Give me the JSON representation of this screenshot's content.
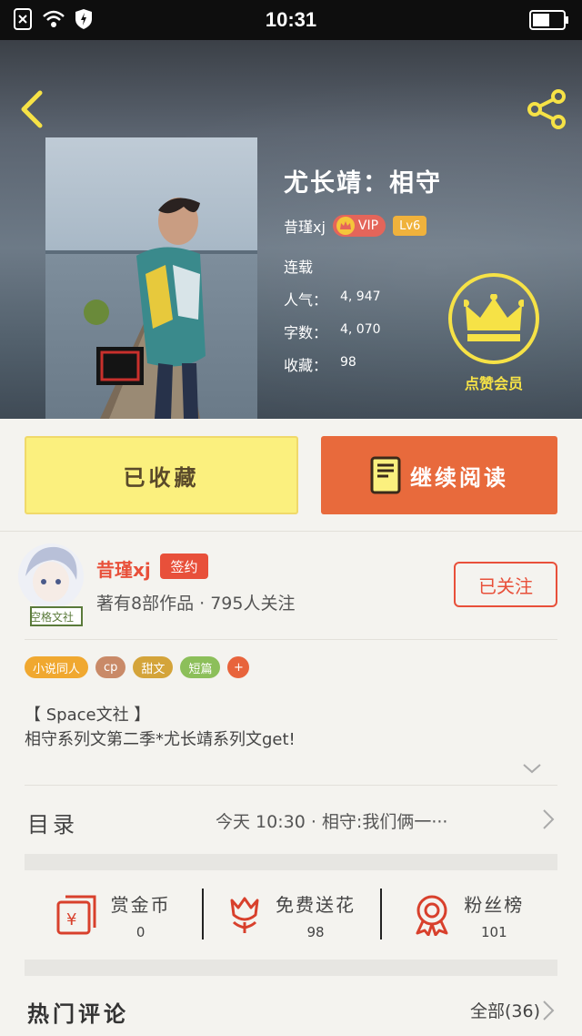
{
  "status_bar": {
    "time": "10:31"
  },
  "header": {
    "back_icon": "chevron-left-icon",
    "share_icon": "share-icon",
    "accent": "#f6e246"
  },
  "book": {
    "title": "尤长靖：相守",
    "author": "昔瑾xj",
    "vip_label": "VIP",
    "level": "Lv6",
    "status": "连载",
    "popularity_label": "人气：",
    "popularity": "4, 947",
    "words_label": "字数：",
    "words": "4, 070",
    "favorites_label": "收藏：",
    "favorites": "98"
  },
  "member": {
    "label": "点赞会员"
  },
  "actions": {
    "collected_label": "已收藏",
    "read_label": "继续阅读",
    "collected_color": "#fbf07e",
    "read_color": "#e86a3c"
  },
  "author_section": {
    "name": "昔瑾xj",
    "sign_badge": "签约",
    "meta": "著有8部作品 · 795人关注",
    "follow_label": "已关注",
    "avatar_caption": "空格文社"
  },
  "tags": [
    {
      "label": "小说同人",
      "color": "#f0a830"
    },
    {
      "label": "cp",
      "color": "#c98a68"
    },
    {
      "label": "甜文",
      "color": "#d4a43a"
    },
    {
      "label": "短篇",
      "color": "#8cbf5a"
    },
    {
      "label": "+",
      "color": "#e8643c"
    }
  ],
  "description": {
    "line1": "【 Space文社 】",
    "line2": "相守系列文第二季*尤长靖系列文get!"
  },
  "catalog": {
    "title": "目录",
    "latest": "今天 10:30 · 相守:我们俩一···"
  },
  "stats": [
    {
      "name": "赏金币",
      "value": "0",
      "icon": "red-envelope-icon"
    },
    {
      "name": "免费送花",
      "value": "98",
      "icon": "flower-icon"
    },
    {
      "name": "粉丝榜",
      "value": "101",
      "icon": "medal-icon"
    }
  ],
  "comments": {
    "title": "热门评论",
    "all_label": "全部(36)"
  }
}
